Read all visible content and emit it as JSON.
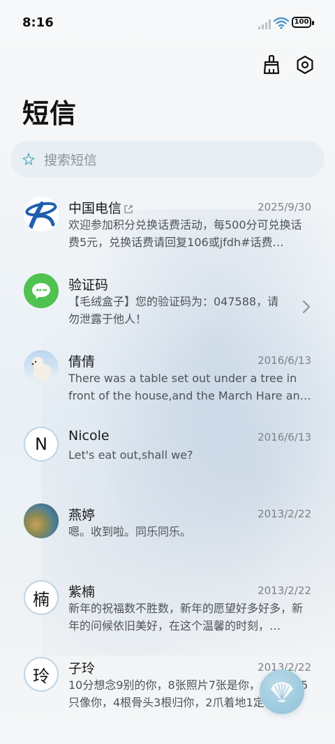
{
  "status_bar": {
    "time": "8:16",
    "battery": "100"
  },
  "header": {
    "title": "短信"
  },
  "search": {
    "placeholder": "搜索短信"
  },
  "conversations": [
    {
      "name": "中国电信",
      "date": "2025/9/30",
      "preview": "欢迎参加积分兑换话费活动，每500分可兑换话费5元，兑换话费请回复106或jfdh#话费…",
      "avatar": "china-telecom-logo"
    },
    {
      "name": "验证码",
      "date": "",
      "preview": "【毛绒盒子】您的验证码为：047588，请勿泄露于他人！",
      "avatar": "message-icon"
    },
    {
      "name": "倩倩",
      "date": "2016/6/13",
      "preview": "There was a table set out under a tree in front of the house,and the March Hare an…",
      "avatar": "polar-bear-photo"
    },
    {
      "name": "Nicole",
      "date": "2016/6/13",
      "preview": "Let's eat out,shall we?",
      "avatar_letter": "N"
    },
    {
      "name": "燕婷",
      "date": "2013/2/22",
      "preview": "嗯。收到啦。同乐同乐。",
      "avatar": "landscape-photo"
    },
    {
      "name": "紫楠",
      "date": "2013/2/22",
      "preview": "新年的祝福数不胜数，新年的愿望好多好多，新年的问候依旧美好，在这个温馨的时刻，…",
      "avatar_letter": "楠"
    },
    {
      "name": "子玲",
      "date": "2013/2/22",
      "preview": "10分想念9别的你，8张照片7张是你，6只小狗5只像你，4根骨头3根归你，2爪着地1定…",
      "avatar_letter": "玲"
    }
  ],
  "colors": {
    "accent_green": "#4fc24f",
    "telecom_blue": "#1f5fae",
    "fab": "#9cc8dd"
  }
}
